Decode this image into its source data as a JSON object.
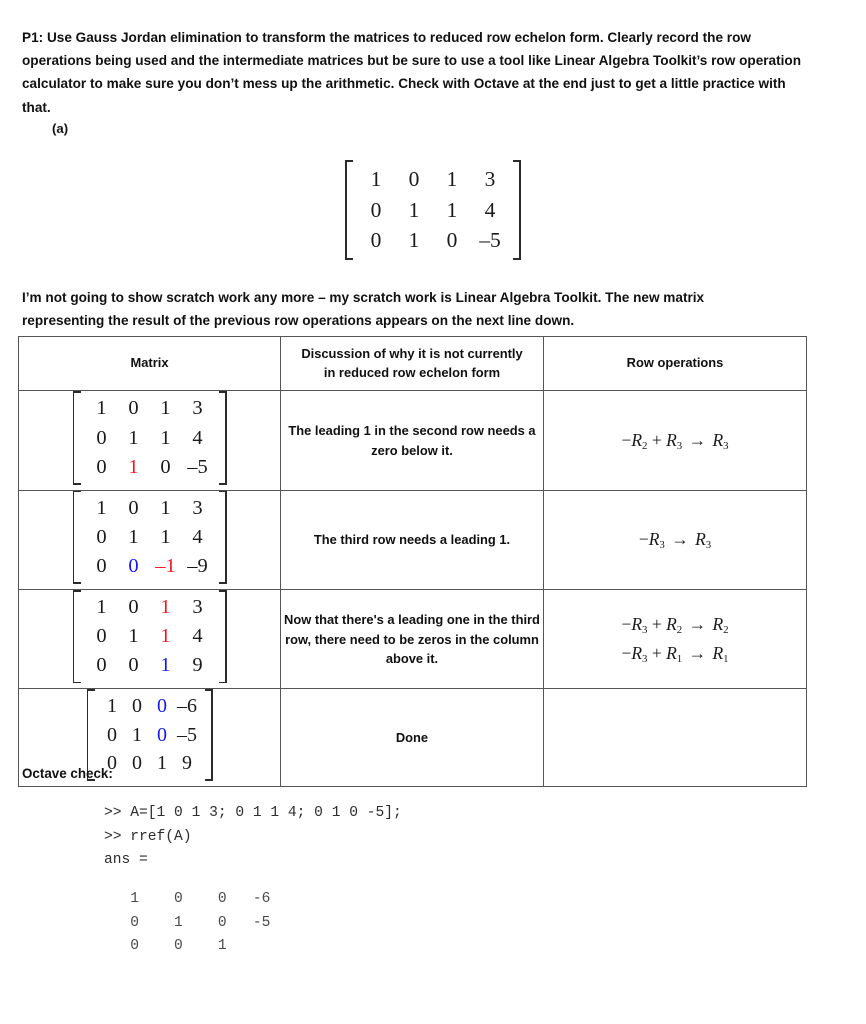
{
  "document": {
    "problem_label": "P1:",
    "problem_text": "Use Gauss Jordan elimination to transform the matrices to reduced row echelon form. Clearly record the row operations being used and the intermediate matrices but be sure to use a tool like Linear Algebra Toolkit’s row operation calculator to make sure you don’t mess up the arithmetic. Check with Octave at the end just to get a little practice with that.",
    "part_label": "(a)",
    "note_paragraph": "I’m not going to show scratch work any more – my scratch work is Linear Algebra Toolkit. The new matrix representing the result of the previous row operations appears on the next line down.",
    "octave_label": "Octave check:"
  },
  "colors": {
    "red": "#ee1b24",
    "blue": "#1717ef",
    "text": "#111111",
    "table_border": "#555555",
    "background": "#ffffff"
  },
  "display_matrix": {
    "rows": [
      [
        {
          "v": "1"
        },
        {
          "v": "0"
        },
        {
          "v": "1"
        },
        {
          "v": "3"
        }
      ],
      [
        {
          "v": "0"
        },
        {
          "v": "1"
        },
        {
          "v": "1"
        },
        {
          "v": "4"
        }
      ],
      [
        {
          "v": "0"
        },
        {
          "v": "1"
        },
        {
          "v": "0"
        },
        {
          "v": "–5"
        }
      ]
    ]
  },
  "table": {
    "headers": {
      "matrix": "Matrix",
      "discussion_line1": "Discussion of why it is not currently",
      "discussion_line2": "in reduced row echelon form",
      "operations": "Row operations"
    },
    "rows": [
      {
        "matrix": [
          [
            {
              "v": "1",
              "c": ""
            },
            {
              "v": "0",
              "c": ""
            },
            {
              "v": "1",
              "c": ""
            },
            {
              "v": "3",
              "c": ""
            }
          ],
          [
            {
              "v": "0",
              "c": ""
            },
            {
              "v": "1",
              "c": ""
            },
            {
              "v": "1",
              "c": ""
            },
            {
              "v": "4",
              "c": ""
            }
          ],
          [
            {
              "v": "0",
              "c": ""
            },
            {
              "v": "1",
              "c": "red"
            },
            {
              "v": "0",
              "c": ""
            },
            {
              "v": "–5",
              "c": ""
            }
          ]
        ],
        "discussion": "The leading 1 in the second row needs a zero below it.",
        "operations": [
          {
            "sign": "−",
            "a": "R",
            "asub": "2",
            "plus": "+",
            "b": "R",
            "bsub": "3",
            "arrow": "→",
            "r": "R",
            "rsub": "3"
          }
        ]
      },
      {
        "matrix": [
          [
            {
              "v": "1",
              "c": ""
            },
            {
              "v": "0",
              "c": ""
            },
            {
              "v": "1",
              "c": ""
            },
            {
              "v": "3",
              "c": ""
            }
          ],
          [
            {
              "v": "0",
              "c": ""
            },
            {
              "v": "1",
              "c": ""
            },
            {
              "v": "1",
              "c": ""
            },
            {
              "v": "4",
              "c": ""
            }
          ],
          [
            {
              "v": "0",
              "c": ""
            },
            {
              "v": "0",
              "c": "blue"
            },
            {
              "v": "–1",
              "c": "red"
            },
            {
              "v": "–9",
              "c": ""
            }
          ]
        ],
        "discussion": "The third row needs a leading 1.",
        "operations": [
          {
            "sign": "−",
            "a": "R",
            "asub": "3",
            "plus": "",
            "b": "",
            "bsub": "",
            "arrow": "→",
            "r": "R",
            "rsub": "3"
          }
        ]
      },
      {
        "matrix": [
          [
            {
              "v": "1",
              "c": ""
            },
            {
              "v": "0",
              "c": ""
            },
            {
              "v": "1",
              "c": "red"
            },
            {
              "v": "3",
              "c": ""
            }
          ],
          [
            {
              "v": "0",
              "c": ""
            },
            {
              "v": "1",
              "c": ""
            },
            {
              "v": "1",
              "c": "red"
            },
            {
              "v": "4",
              "c": ""
            }
          ],
          [
            {
              "v": "0",
              "c": ""
            },
            {
              "v": "0",
              "c": ""
            },
            {
              "v": "1",
              "c": "blue"
            },
            {
              "v": "9",
              "c": ""
            }
          ]
        ],
        "discussion": "Now that there's a leading one in the third row, there need to be zeros in the column above it.",
        "operations": [
          {
            "sign": "−",
            "a": "R",
            "asub": "3",
            "plus": "+",
            "b": "R",
            "bsub": "2",
            "arrow": "→",
            "r": "R",
            "rsub": "2"
          },
          {
            "sign": "−",
            "a": "R",
            "asub": "3",
            "plus": "+",
            "b": "R",
            "bsub": "1",
            "arrow": "→",
            "r": "R",
            "rsub": "1"
          }
        ]
      },
      {
        "matrix": [
          [
            {
              "v": "1",
              "c": ""
            },
            {
              "v": "0",
              "c": ""
            },
            {
              "v": "0",
              "c": "blue"
            },
            {
              "v": "–6",
              "c": ""
            }
          ],
          [
            {
              "v": "0",
              "c": ""
            },
            {
              "v": "1",
              "c": ""
            },
            {
              "v": "0",
              "c": "blue"
            },
            {
              "v": "–5",
              "c": ""
            }
          ],
          [
            {
              "v": "0",
              "c": ""
            },
            {
              "v": "0",
              "c": ""
            },
            {
              "v": "1",
              "c": ""
            },
            {
              "v": "9",
              "c": ""
            }
          ]
        ],
        "discussion": "Done",
        "operations": []
      }
    ]
  },
  "octave": {
    "commands": ">> A=[1 0 1 3; 0 1 1 4; 0 1 0 -5];\n>> rref(A)\nans =",
    "output": "   1    0    0   -6\n   0    1    0   -5\n   0    0    1"
  }
}
